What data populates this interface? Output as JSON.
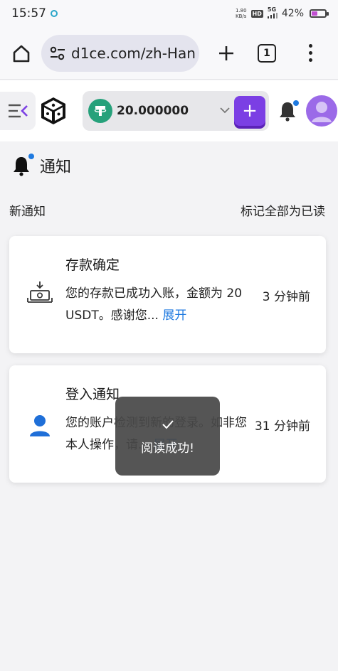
{
  "status_bar": {
    "time": "15:57",
    "net_speed": "1.80",
    "net_unit": "KB/s",
    "hd": "HD",
    "network": "5G",
    "battery": "42%",
    "battery_level": 0.42,
    "battery_color": "#c14fd1"
  },
  "browser": {
    "url": "d1ce.com/zh-Han",
    "tab_count": "1"
  },
  "header": {
    "balance": "20.000000",
    "currency_icon": "tether-icon",
    "deposit_label": "+",
    "accent_color": "#7b3fe4"
  },
  "page": {
    "title": "通知",
    "new_notifications_label": "新通知",
    "mark_all_read_label": "标记全部为已读"
  },
  "notifications": [
    {
      "title": "存款确定",
      "body": "您的存款已成功入账，金额为 20 USDT。感谢您...",
      "expand_label": "展开",
      "time": "3 分钟前",
      "icon": "deposit-icon"
    },
    {
      "title": "登入通知",
      "body": "您的账户检测到新的登录。如非您本人操作，请...",
      "expand_label": "展开",
      "time": "31 分钟前",
      "icon": "user-icon"
    }
  ],
  "toast": {
    "message": "阅读成功!",
    "icon": "check-icon"
  }
}
